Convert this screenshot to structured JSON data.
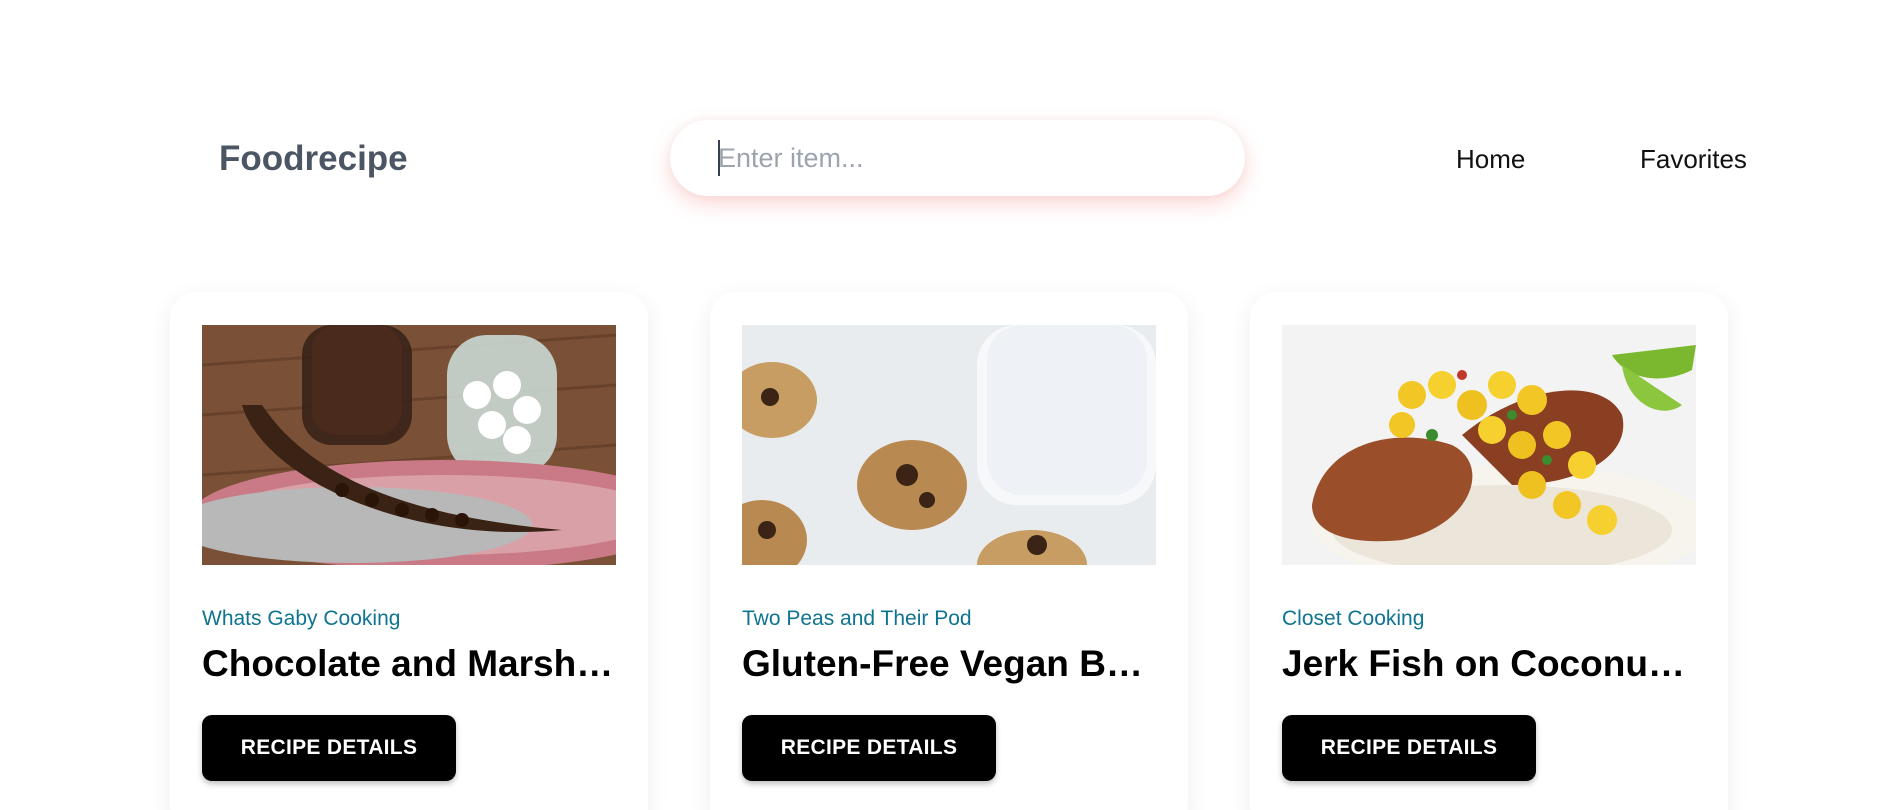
{
  "header": {
    "brand": "Foodrecipe",
    "search": {
      "placeholder": "Enter item...",
      "value": ""
    },
    "nav": [
      {
        "label": "Home"
      },
      {
        "label": "Favorites"
      }
    ]
  },
  "recipes": [
    {
      "publisher": "Whats Gaby Cooking",
      "title": "Chocolate and Marshmallow Stuffed Banana Boats",
      "button": "RECIPE DETAILS"
    },
    {
      "publisher": "Two Peas and Their Pod",
      "title": "Gluten-Free Vegan Banana Oatmeal Cookies",
      "button": "RECIPE DETAILS"
    },
    {
      "publisher": "Closet Cooking",
      "title": "Jerk Fish on Coconut Rice with Pineapple Salsa",
      "button": "RECIPE DETAILS"
    }
  ],
  "colors": {
    "brand": "#4b5563",
    "publisher": "#0e7490",
    "button_bg": "#000000",
    "search_shadow": "#f87171"
  }
}
